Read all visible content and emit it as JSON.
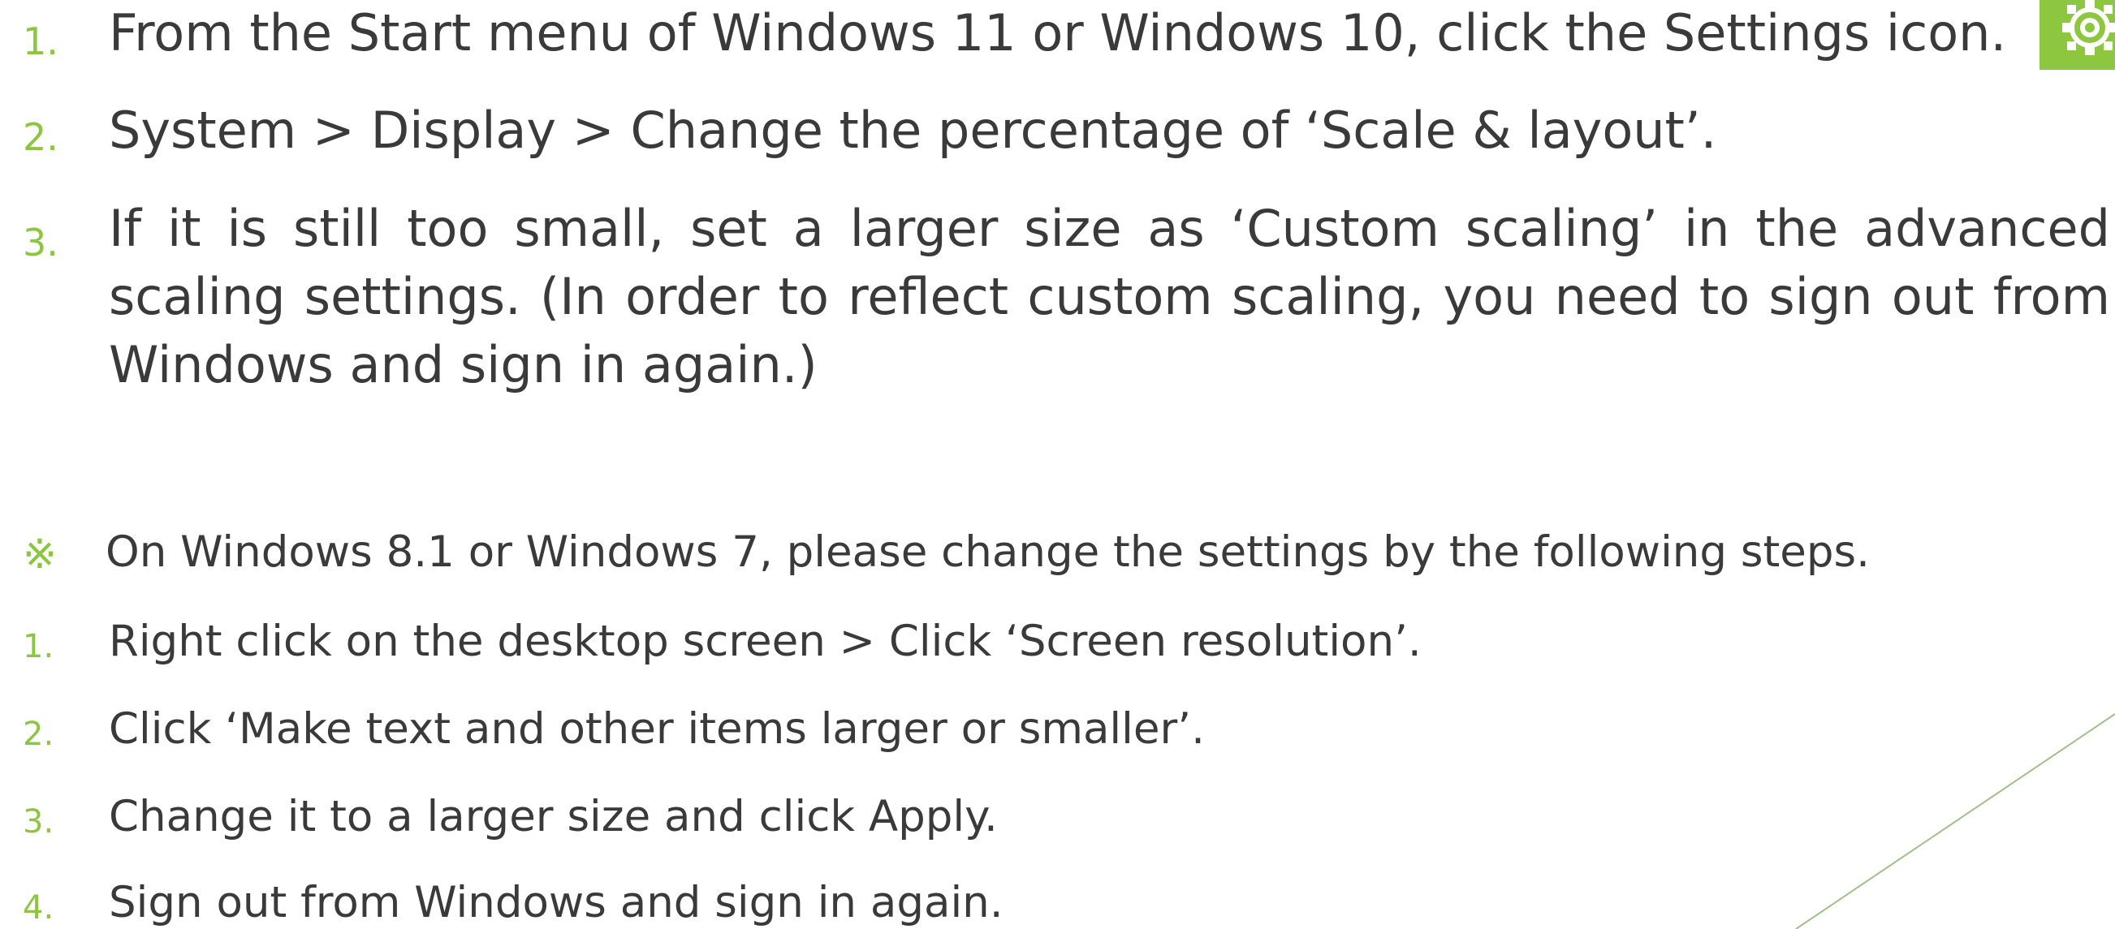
{
  "main_steps": [
    {
      "number": "1.",
      "text": "From the Start menu of Windows 11 or Windows 10, click the Settings icon."
    },
    {
      "number": "2.",
      "text": "System > Display > Change the percentage of ‘Scale & layout’."
    },
    {
      "number": "3.",
      "text": "If it is still too small, set a larger size as ‘Custom scaling’ in the advanced scaling settings. (In order to reflect custom scaling, you need to sign out from Windows and sign in again.)"
    }
  ],
  "note": {
    "symbol": "※",
    "text": "On Windows 8.1 or Windows 7, please change the settings by the following steps."
  },
  "legacy_steps": [
    {
      "number": "1.",
      "text": "Right click on the desktop screen > Click ‘Screen resolution’."
    },
    {
      "number": "2.",
      "text": "Click ‘Make text and other items larger or smaller’."
    },
    {
      "number": "3.",
      "text": "Change it to a larger size and click Apply."
    },
    {
      "number": "4.",
      "text": "Sign out from Windows and sign in again."
    }
  ],
  "settings_icon": {
    "name": "gear-icon",
    "color": "#8dc63f"
  },
  "colors": {
    "accent": "#8cc63f",
    "text": "#3a3a3a",
    "line": "#9fbf88"
  }
}
